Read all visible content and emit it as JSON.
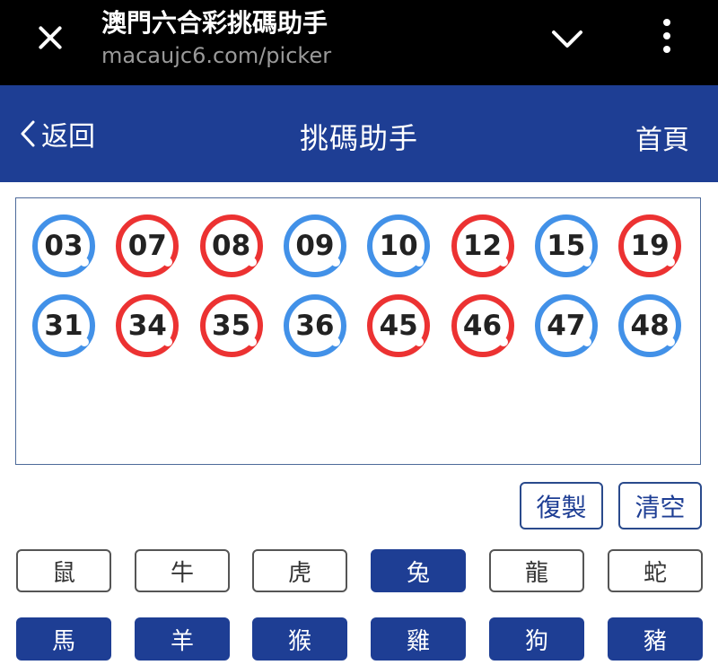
{
  "browser": {
    "title": "澳門六合彩挑碼助手",
    "url": "macaujc6.com/picker"
  },
  "header": {
    "back_label": "返回",
    "title": "挑碼助手",
    "home_label": "首頁"
  },
  "balls": [
    {
      "number": "03",
      "color": "blue"
    },
    {
      "number": "07",
      "color": "red"
    },
    {
      "number": "08",
      "color": "red"
    },
    {
      "number": "09",
      "color": "blue"
    },
    {
      "number": "10",
      "color": "blue"
    },
    {
      "number": "12",
      "color": "red"
    },
    {
      "number": "15",
      "color": "blue"
    },
    {
      "number": "19",
      "color": "red"
    },
    {
      "number": "31",
      "color": "blue"
    },
    {
      "number": "34",
      "color": "red"
    },
    {
      "number": "35",
      "color": "red"
    },
    {
      "number": "36",
      "color": "blue"
    },
    {
      "number": "45",
      "color": "red"
    },
    {
      "number": "46",
      "color": "red"
    },
    {
      "number": "47",
      "color": "blue"
    },
    {
      "number": "48",
      "color": "blue"
    }
  ],
  "actions": {
    "copy_label": "復製",
    "clear_label": "清空"
  },
  "zodiac": [
    {
      "label": "鼠",
      "selected": false
    },
    {
      "label": "牛",
      "selected": false
    },
    {
      "label": "虎",
      "selected": false
    },
    {
      "label": "兔",
      "selected": true
    },
    {
      "label": "龍",
      "selected": false
    },
    {
      "label": "蛇",
      "selected": false
    },
    {
      "label": "馬",
      "selected": true
    },
    {
      "label": "羊",
      "selected": true
    },
    {
      "label": "猴",
      "selected": true
    },
    {
      "label": "雞",
      "selected": true
    },
    {
      "label": "狗",
      "selected": true
    },
    {
      "label": "豬",
      "selected": true
    }
  ],
  "colors": {
    "ball_blue": "#4291e8",
    "ball_red": "#ec3232",
    "brand_blue": "#1e3e94"
  }
}
